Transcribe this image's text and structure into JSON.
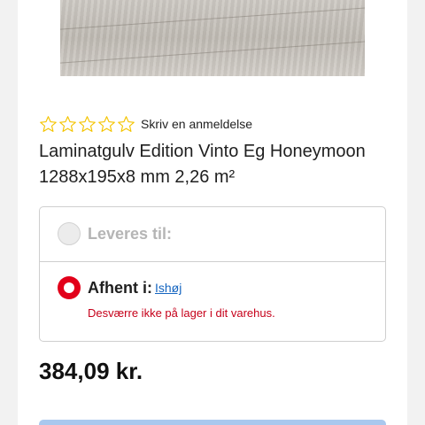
{
  "product": {
    "title": "Laminatgulv Edition Vinto Eg Honeymoon 1288x195x8 mm 2,26 m²",
    "rating": {
      "stars_total": 5,
      "stars_filled": 0,
      "review_label": "Skriv en anmeldelse"
    },
    "price": "384,09 kr."
  },
  "delivery": {
    "ship_label": "Leveres til:",
    "pickup_label": "Afhent i:",
    "pickup_store": "Ishøj",
    "stock_message": "Desværre ikke på lager i dit varehus."
  },
  "colors": {
    "star_outline": "#f4c400",
    "accent_red": "#e2001a",
    "link_blue": "#1565c0",
    "button_blue": "#a9c8ee"
  }
}
